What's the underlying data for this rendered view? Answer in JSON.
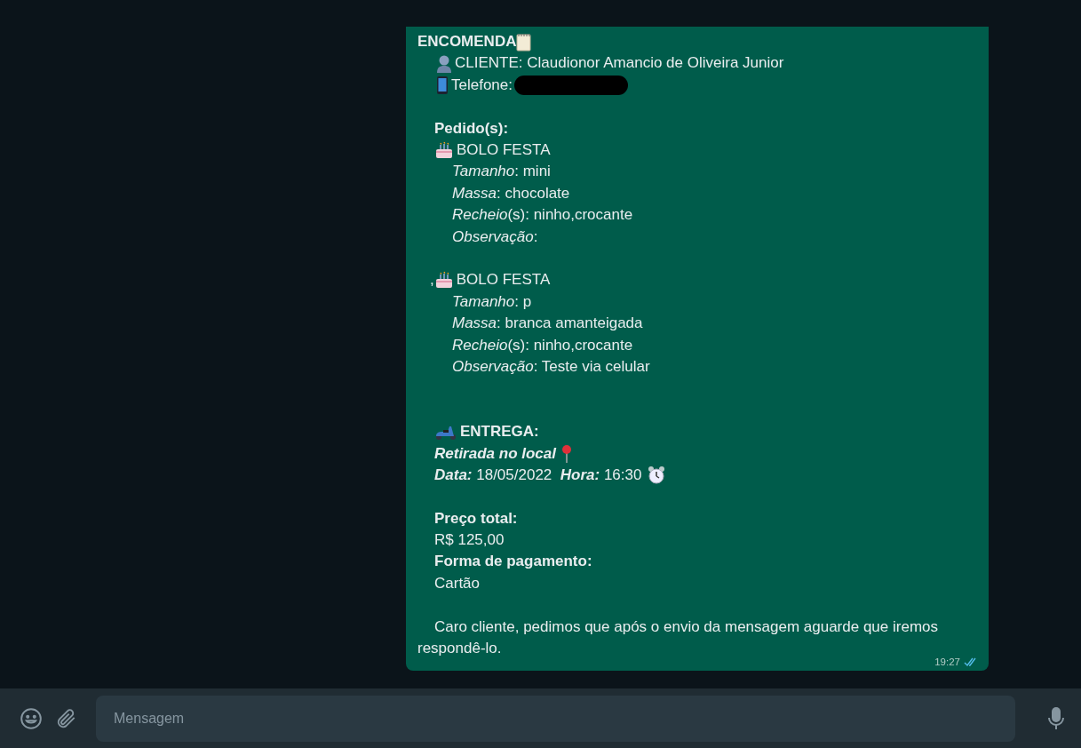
{
  "message": {
    "lines": [
      {
        "kind": "title",
        "text": "ENCOMENDA"
      },
      {
        "kind": "client",
        "text": "CLIENTE: Claudionor Amancio de Oliveira Junior"
      },
      {
        "kind": "phone",
        "text": "Telefone:"
      },
      {
        "kind": "blank"
      },
      {
        "kind": "heading",
        "text": "Pedido(s):"
      },
      {
        "kind": "item",
        "text": "BOLO FESTA"
      },
      {
        "kind": "attr",
        "text": "*Tamanho*: mini"
      },
      {
        "kind": "attr",
        "text": "*Massa*: chocolate"
      },
      {
        "kind": "attr",
        "text": "*Recheio*(s): ninho,crocante"
      },
      {
        "kind": "attr",
        "text": "*Observação*:"
      },
      {
        "kind": "blank"
      },
      {
        "kind": "item",
        "prefix": ",",
        "text": "BOLO FESTA"
      },
      {
        "kind": "attr",
        "text": "*Tamanho*: p"
      },
      {
        "kind": "attr",
        "text": "*Massa*: branca amanteigada"
      },
      {
        "kind": "attr",
        "text": "*Recheio*(s): ninho,crocante"
      },
      {
        "kind": "attr",
        "text": "*Observação*: Teste via celular"
      },
      {
        "kind": "blank"
      },
      {
        "kind": "blank"
      },
      {
        "kind": "delivery",
        "text": "ENTREGA:"
      },
      {
        "kind": "pickup",
        "text": "Retirada no local"
      },
      {
        "kind": "datetime",
        "text": "**Data:** 18/05/2022  **Hora:** 16:30"
      },
      {
        "kind": "blank"
      },
      {
        "kind": "heading",
        "text": "Preço total:"
      },
      {
        "kind": "value",
        "text": "R$ 125,00"
      },
      {
        "kind": "heading",
        "text": "Forma de pagamento:"
      },
      {
        "kind": "value",
        "text": "Cartão"
      },
      {
        "kind": "blank"
      },
      {
        "kind": "para",
        "text": "Caro cliente, pedimos que após o envio da mensagem aguarde que iremos respondê-lo."
      }
    ],
    "time": "19:27",
    "read": true
  },
  "composer": {
    "placeholder": "Mensagem"
  }
}
